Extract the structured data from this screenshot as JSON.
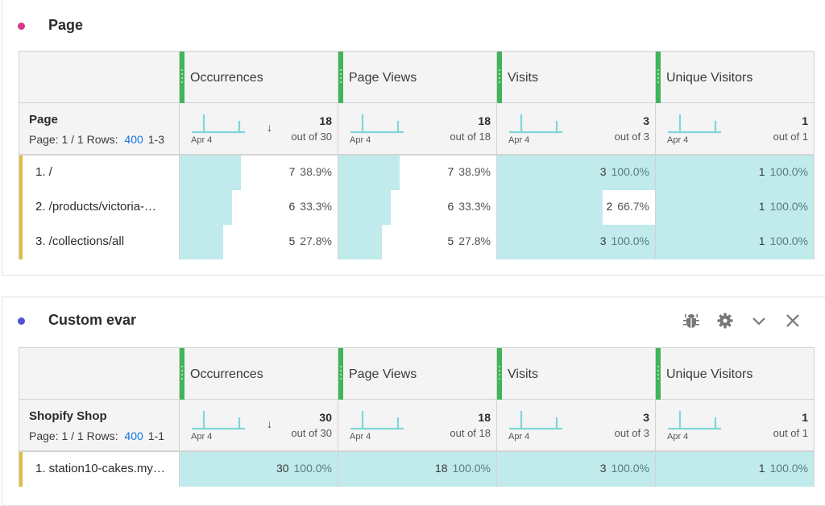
{
  "colors": {
    "panel1_dot": "#d83790",
    "panel2_dot": "#5151d3",
    "metric_grip": "#3fb559",
    "bar_fill": "#c0eaeb",
    "row_marker": "#e0be3c",
    "link": "#1473e6",
    "sparkline": "#7fd6db"
  },
  "metrics": [
    "Occurrences",
    "Page Views",
    "Visits",
    "Unique Visitors"
  ],
  "panels": [
    {
      "title": "Page",
      "dimension": "Page",
      "pager_prefix": "Page: 1 / 1 Rows:",
      "rows_per_page": "400",
      "range": "1-3",
      "sort_icon": "↓",
      "summary": [
        {
          "spark_label": "Apr 4",
          "total": "18",
          "out_of": "out of 30"
        },
        {
          "spark_label": "Apr 4",
          "total": "18",
          "out_of": "out of 18"
        },
        {
          "spark_label": "Apr 4",
          "total": "3",
          "out_of": "out of 3"
        },
        {
          "spark_label": "Apr 4",
          "total": "1",
          "out_of": "out of 1"
        }
      ],
      "rows": [
        {
          "label": "1.  /",
          "cells": [
            {
              "value": "7",
              "pct": "38.9%",
              "fraction": 0.389
            },
            {
              "value": "7",
              "pct": "38.9%",
              "fraction": 0.389
            },
            {
              "value": "3",
              "pct": "100.0%",
              "fraction": 1.0
            },
            {
              "value": "1",
              "pct": "100.0%",
              "fraction": 1.0
            }
          ]
        },
        {
          "label": "2.  /products/victoria-…",
          "cells": [
            {
              "value": "6",
              "pct": "33.3%",
              "fraction": 0.333
            },
            {
              "value": "6",
              "pct": "33.3%",
              "fraction": 0.333
            },
            {
              "value": "2",
              "pct": "66.7%",
              "fraction": 0.667
            },
            {
              "value": "1",
              "pct": "100.0%",
              "fraction": 1.0
            }
          ]
        },
        {
          "label": "3.  /collections/all",
          "cells": [
            {
              "value": "5",
              "pct": "27.8%",
              "fraction": 0.278
            },
            {
              "value": "5",
              "pct": "27.8%",
              "fraction": 0.278
            },
            {
              "value": "3",
              "pct": "100.0%",
              "fraction": 1.0
            },
            {
              "value": "1",
              "pct": "100.0%",
              "fraction": 1.0
            }
          ]
        }
      ]
    },
    {
      "title": "Custom evar",
      "dimension": "Shopify Shop",
      "pager_prefix": "Page: 1 / 1 Rows:",
      "rows_per_page": "400",
      "range": "1-1",
      "sort_icon": "↓",
      "tools": [
        "bug-icon",
        "gear-icon",
        "chevron-down-icon",
        "close-icon"
      ],
      "summary": [
        {
          "spark_label": "Apr 4",
          "total": "30",
          "out_of": "out of 30"
        },
        {
          "spark_label": "Apr 4",
          "total": "18",
          "out_of": "out of 18"
        },
        {
          "spark_label": "Apr 4",
          "total": "3",
          "out_of": "out of 3"
        },
        {
          "spark_label": "Apr 4",
          "total": "1",
          "out_of": "out of 1"
        }
      ],
      "rows": [
        {
          "label": "1.  station10-cakes.my…",
          "cells": [
            {
              "value": "30",
              "pct": "100.0%",
              "fraction": 1.0
            },
            {
              "value": "18",
              "pct": "100.0%",
              "fraction": 1.0
            },
            {
              "value": "3",
              "pct": "100.0%",
              "fraction": 1.0
            },
            {
              "value": "1",
              "pct": "100.0%",
              "fraction": 1.0
            }
          ]
        }
      ]
    }
  ]
}
